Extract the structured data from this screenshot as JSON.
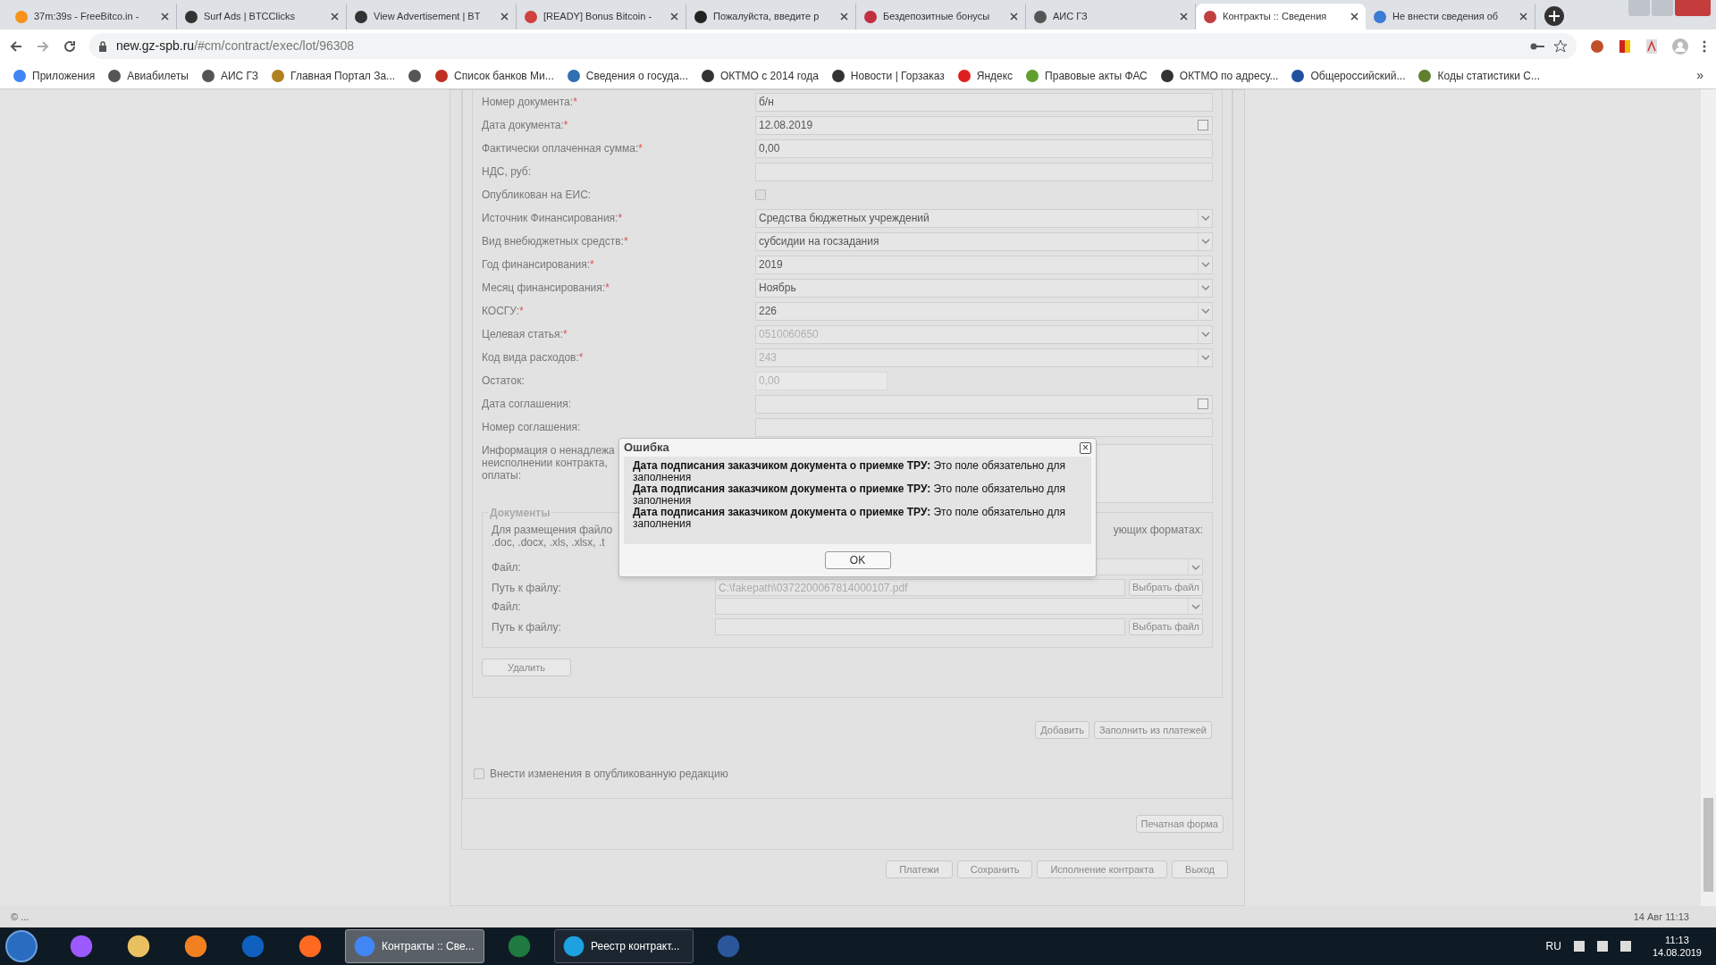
{
  "tabs": [
    {
      "label": "37m:39s - FreeBitco.in -",
      "color": "#f7931a",
      "selected": false
    },
    {
      "label": "Surf Ads | BTCClicks",
      "color": "#333333",
      "selected": false
    },
    {
      "label": "View Advertisement | BT",
      "color": "#333333",
      "selected": false
    },
    {
      "label": "[READY] Bonus Bitcoin -",
      "color": "#d04040",
      "selected": false
    },
    {
      "label": "Пожалуйста, введите р",
      "color": "#222222",
      "selected": false
    },
    {
      "label": "Бездепозитные бонусы",
      "color": "#c03040",
      "selected": false
    },
    {
      "label": "АИС ГЗ",
      "color": "#555555",
      "selected": false
    },
    {
      "label": "Контракты :: Сведения",
      "color": "#c04040",
      "selected": true
    },
    {
      "label": "Не внести сведения об",
      "color": "#3a7bd5",
      "selected": false
    }
  ],
  "address": {
    "host": "new.gz-spb.ru",
    "path": "/#cm/contract/exec/lot/96308"
  },
  "bookmarks": [
    {
      "label": "Приложения",
      "color": "#4285f4"
    },
    {
      "label": "Авиабилеты",
      "color": "#555555"
    },
    {
      "label": "АИС ГЗ",
      "color": "#555555"
    },
    {
      "label": "Главная Портал За...",
      "color": "#b08020"
    },
    {
      "color": "#555555"
    },
    {
      "label": "Список банков Ми...",
      "color": "#c03020"
    },
    {
      "label": "Сведения о госуда...",
      "color": "#3070b0"
    },
    {
      "label": "ОКТМО с 2014 года",
      "color": "#333333"
    },
    {
      "label": "Новости | Горзаказ",
      "color": "#333333"
    },
    {
      "label": "Яндекс",
      "color": "#e02020"
    },
    {
      "label": "Правовые акты ФАС",
      "color": "#60a030"
    },
    {
      "label": "ОКТМО по адресу...",
      "color": "#333333"
    },
    {
      "label": "Общероссийский...",
      "color": "#2050a0"
    },
    {
      "label": "Коды статистики С...",
      "color": "#608030"
    }
  ],
  "bookmarks_more": "»",
  "form_rows": [
    {
      "label": "Номер документа:",
      "required_mark": "*",
      "kind": "text",
      "value": "б/н",
      "disabled": false
    },
    {
      "label": "Дата документа:",
      "required_mark": "*",
      "kind": "date",
      "value": "12.08.2019",
      "disabled": false
    },
    {
      "label": "Фактически оплаченная сумма:",
      "required_mark": "*",
      "kind": "text",
      "value": "0,00",
      "disabled": false
    },
    {
      "label": "НДС, руб:",
      "kind": "text"
    },
    {
      "label": "Опубликован на ЕИС:",
      "kind": "checkbox",
      "checked": false,
      "disabled": true
    },
    {
      "label": "Источник Финансирования:",
      "required_mark": "*",
      "kind": "select",
      "value": "Средства бюджетных учреждений",
      "disabled": false
    },
    {
      "label": "Вид внебюджетных средств:",
      "required_mark": "*",
      "kind": "select",
      "value": "субсидии на госзадания",
      "disabled": false
    },
    {
      "label": "Год финансирования:",
      "required_mark": "*",
      "kind": "select",
      "value": "2019",
      "disabled": false
    },
    {
      "label": "Месяц финансирования:",
      "required_mark": "*",
      "kind": "select",
      "value": "Ноябрь",
      "disabled": false
    },
    {
      "label": "КОСГУ:",
      "required_mark": "*",
      "kind": "select",
      "value": "226",
      "disabled": false
    },
    {
      "label": "Целевая статья:",
      "required_mark": "*",
      "kind": "select",
      "value": "0510060650",
      "disabled": true
    },
    {
      "label": "Код вида расходов:",
      "required_mark": "*",
      "kind": "select",
      "value": "243",
      "disabled": true
    },
    {
      "label": "Остаток:",
      "kind": "short",
      "value": "0,00",
      "disabled": true
    },
    {
      "label": "Дата соглашения:",
      "kind": "date"
    },
    {
      "label": "Номер соглашения:",
      "kind": "text"
    }
  ],
  "info_label_lines": [
    "Информация о ненадлежа",
    "неисполнении контракта,",
    "оплаты:"
  ],
  "documents": {
    "title": "Документы",
    "note_left": [
      "Для размещения файло",
      ".doc, .docx, .xls, .xlsx, .t"
    ],
    "note_right": "ующих форматах:",
    "files": [
      {
        "label": "Файл:",
        "path_label": "Путь к файлу:",
        "path": "C:\\fakepath\\0372200067814000107.pdf",
        "choose": "Выбрать файл"
      },
      {
        "label": "Файл:",
        "path_label": "Путь к файлу:",
        "choose": "Выбрать файл"
      }
    ],
    "delete": "Удалить"
  },
  "add_buttons": [
    "Добавить",
    "Заполнить из платежей"
  ],
  "publish_change": {
    "label": "Внести изменения в опубликованную редакцию",
    "checked": false
  },
  "print_button": "Печатная форма",
  "bottom_buttons": [
    "Платежи",
    "Сохранить",
    "Исполнение контракта",
    "Выход"
  ],
  "dialog": {
    "title": "Ошибка",
    "close": "×",
    "messages": [
      {
        "field": "Дата подписания заказчиком документа о приемке ТРУ:",
        "text": "Это поле обязательно для заполнения"
      },
      {
        "field": "Дата подписания заказчиком документа о приемке ТРУ:",
        "text": "Это поле обязательно для заполнения"
      },
      {
        "field": "Дата подписания заказчиком документа о приемке ТРУ:",
        "text": "Это поле обязательно для заполнения"
      }
    ],
    "ok": "OK"
  },
  "status_bar": {
    "left": "© ...",
    "right": "14 Авг 11:13"
  },
  "taskbar": {
    "apps": [
      {
        "kind": "pinned",
        "color": "#9b59ff"
      },
      {
        "kind": "pinned",
        "color": "#e8c060"
      },
      {
        "kind": "pinned",
        "color": "#f08020"
      },
      {
        "kind": "pinned",
        "color": "#1060c0"
      },
      {
        "kind": "pinned",
        "color": "#ff6a20"
      },
      {
        "kind": "running",
        "color": "#4285f4",
        "label": "Контракты :: Све...",
        "selected": true
      },
      {
        "kind": "pinned",
        "color": "#1f7a3f"
      },
      {
        "kind": "running",
        "color": "#1da1e0",
        "label": "Реестр контракт...",
        "selected": false
      },
      {
        "kind": "pinned",
        "color": "#2b579a"
      }
    ],
    "lang": "RU",
    "time": "11:13",
    "date": "14.08.2019"
  }
}
